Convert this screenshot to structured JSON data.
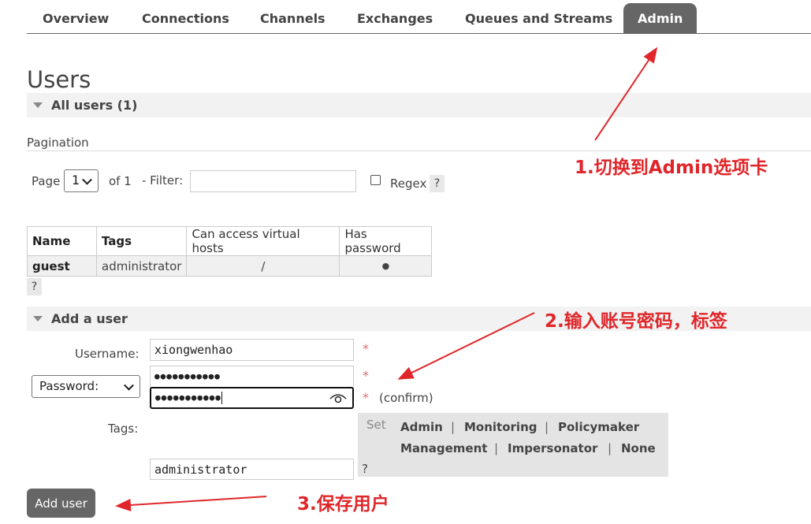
{
  "nav": {
    "tabs": [
      {
        "label": "Overview"
      },
      {
        "label": "Connections"
      },
      {
        "label": "Channels"
      },
      {
        "label": "Exchanges"
      },
      {
        "label": "Queues and Streams"
      },
      {
        "label": "Admin",
        "active": true
      }
    ]
  },
  "page": {
    "title": "Users"
  },
  "all_users": {
    "header": "All users (1)"
  },
  "pagination": {
    "label": "Pagination",
    "page_label": "Page",
    "page_value": "1",
    "of_label": "of 1",
    "filter_label": "- Filter:",
    "filter_value": "",
    "regex_label": "Regex",
    "help": "?"
  },
  "users_table": {
    "columns": [
      "Name",
      "Tags",
      "Can access virtual hosts",
      "Has password"
    ],
    "rows": [
      {
        "name": "guest",
        "tags": "administrator",
        "vhosts": "/",
        "has_password": "●"
      }
    ],
    "help": "?"
  },
  "add_user": {
    "header": "Add a user",
    "username_label": "Username:",
    "username_value": "xiongwenhao",
    "password_type": "Password:",
    "password_mask": "●●●●●●●●●●●",
    "confirm_mask": "●●●●●●●●●●●",
    "required": "*",
    "confirm_label": "(confirm)",
    "tags_label": "Tags:",
    "tags_value": "administrator",
    "tags_help": "?",
    "set_label": "Set",
    "tag_options_row1": [
      "Admin",
      "Monitoring",
      "Policymaker"
    ],
    "tag_options_row2": [
      "Management",
      "Impersonator",
      "None"
    ],
    "separator": "|",
    "submit": "Add user"
  },
  "annotations": {
    "step1": "1.切换到Admin选项卡",
    "step2": "2.输入账号密码，标签",
    "step3": "3.保存用户",
    "color": "#e0262a"
  }
}
